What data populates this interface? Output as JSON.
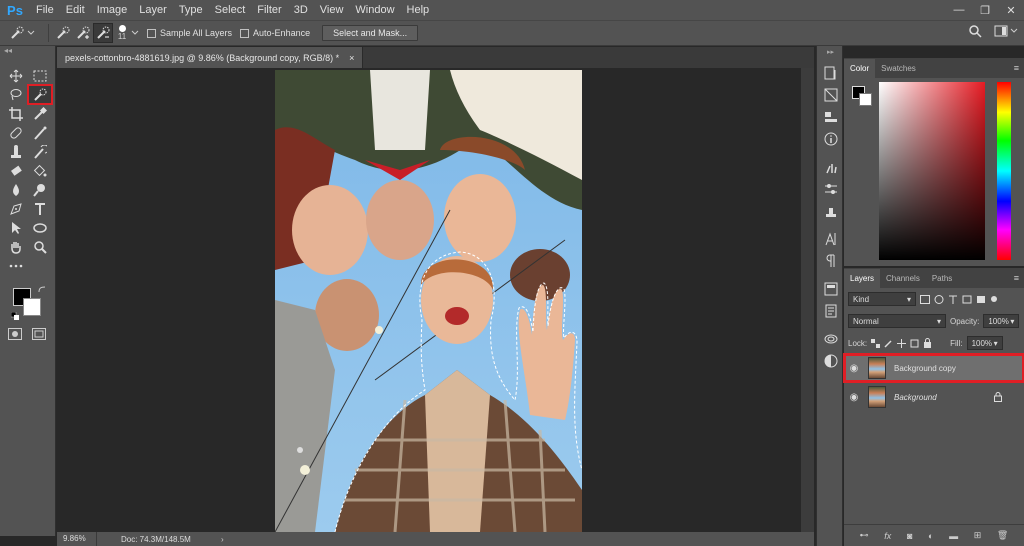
{
  "app": {
    "logo": "Ps"
  },
  "menu": [
    "File",
    "Edit",
    "Image",
    "Layer",
    "Type",
    "Select",
    "Filter",
    "3D",
    "View",
    "Window",
    "Help"
  ],
  "window_controls": {
    "minimize": "—",
    "restore": "❐",
    "close": "✕"
  },
  "options": {
    "brush_size": "11",
    "sample_all_layers": "Sample All Layers",
    "auto_enhance": "Auto-Enhance",
    "select_mask": "Select and Mask..."
  },
  "document": {
    "tab_title": "pexels-cottonbro-4881619.jpg @ 9.86% (Background copy, RGB/8) *",
    "tab_close": "×"
  },
  "status": {
    "zoom": "9.86%",
    "doc": "Doc: 74.3M/148.5M",
    "arrow": "›"
  },
  "color_panel": {
    "tabs": [
      "Color",
      "Swatches"
    ],
    "menu": "≡"
  },
  "layers_panel": {
    "tabs": [
      "Layers",
      "Channels",
      "Paths"
    ],
    "menu": "≡",
    "filter_kind": "Kind",
    "blend_mode": "Normal",
    "opacity_label": "Opacity:",
    "opacity_value": "100%",
    "lock_label": "Lock:",
    "fill_label": "Fill:",
    "fill_value": "100%",
    "layers": [
      {
        "name": "Background copy",
        "selected": true
      },
      {
        "name": "Background",
        "selected": false,
        "locked": true
      }
    ],
    "footer_icons": [
      "link-icon",
      "fx-icon",
      "mask-icon",
      "adjustment-icon",
      "folder-icon",
      "new-layer-icon",
      "trash-icon"
    ]
  },
  "colors": {
    "highlight": "#e01e25",
    "panel": "#535353",
    "ps_blue": "#31a8ff"
  },
  "foreground_color": "#000000",
  "background_color": "#ffffff"
}
